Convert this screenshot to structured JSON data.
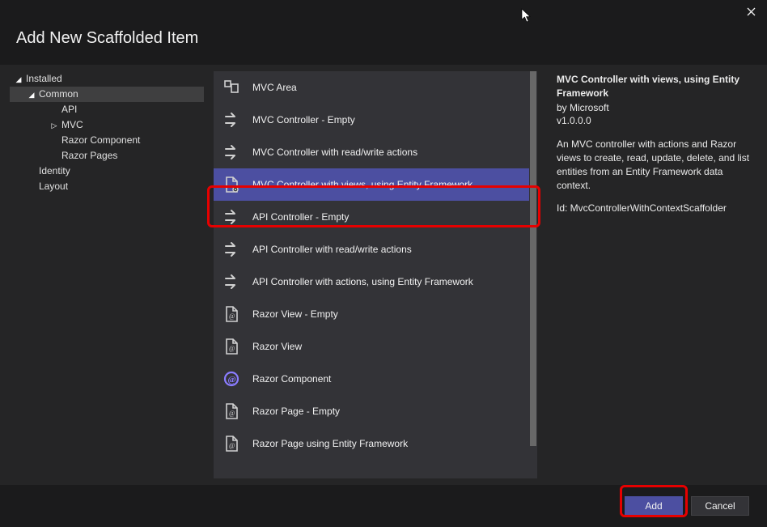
{
  "dialog": {
    "title": "Add New Scaffolded Item"
  },
  "tree": {
    "items": [
      {
        "label": "Installed",
        "indent": 0,
        "expander": "open",
        "selected": false
      },
      {
        "label": "Common",
        "indent": 1,
        "expander": "open",
        "selected": true
      },
      {
        "label": "API",
        "indent": 2,
        "expander": "blank",
        "selected": false
      },
      {
        "label": "MVC",
        "indent": 2,
        "expander": "closed",
        "selected": false
      },
      {
        "label": "Razor Component",
        "indent": 2,
        "expander": "blank",
        "selected": false
      },
      {
        "label": "Razor Pages",
        "indent": 2,
        "expander": "blank",
        "selected": false
      },
      {
        "label": "Identity",
        "indent": 1,
        "expander": "blank",
        "selected": false
      },
      {
        "label": "Layout",
        "indent": 1,
        "expander": "blank",
        "selected": false
      }
    ]
  },
  "templates": {
    "items": [
      {
        "label": "MVC Area",
        "icon": "area-icon",
        "selected": false
      },
      {
        "label": "MVC Controller - Empty",
        "icon": "controller-icon",
        "selected": false
      },
      {
        "label": "MVC Controller with read/write actions",
        "icon": "controller-icon",
        "selected": false
      },
      {
        "label": "MVC Controller with views, using Entity Framework",
        "icon": "file-icon",
        "selected": true
      },
      {
        "label": "API Controller - Empty",
        "icon": "controller-icon",
        "selected": false
      },
      {
        "label": "API Controller with read/write actions",
        "icon": "controller-icon",
        "selected": false
      },
      {
        "label": "API Controller with actions, using Entity Framework",
        "icon": "controller-icon",
        "selected": false
      },
      {
        "label": "Razor View - Empty",
        "icon": "razor-file-icon",
        "selected": false
      },
      {
        "label": "Razor View",
        "icon": "razor-file-icon",
        "selected": false
      },
      {
        "label": "Razor Component",
        "icon": "razor-component-icon",
        "selected": false
      },
      {
        "label": "Razor Page - Empty",
        "icon": "razor-file-icon",
        "selected": false
      },
      {
        "label": "Razor Page using Entity Framework",
        "icon": "razor-file-icon",
        "selected": false
      }
    ]
  },
  "detail": {
    "title": "MVC Controller with views, using Entity Framework",
    "publisher": "by Microsoft",
    "version": "v1.0.0.0",
    "description": "An MVC controller with actions and Razor views to create, read, update, delete, and list entities from an Entity Framework data context.",
    "id": "Id: MvcControllerWithContextScaffolder"
  },
  "buttons": {
    "add": "Add",
    "cancel": "Cancel"
  }
}
